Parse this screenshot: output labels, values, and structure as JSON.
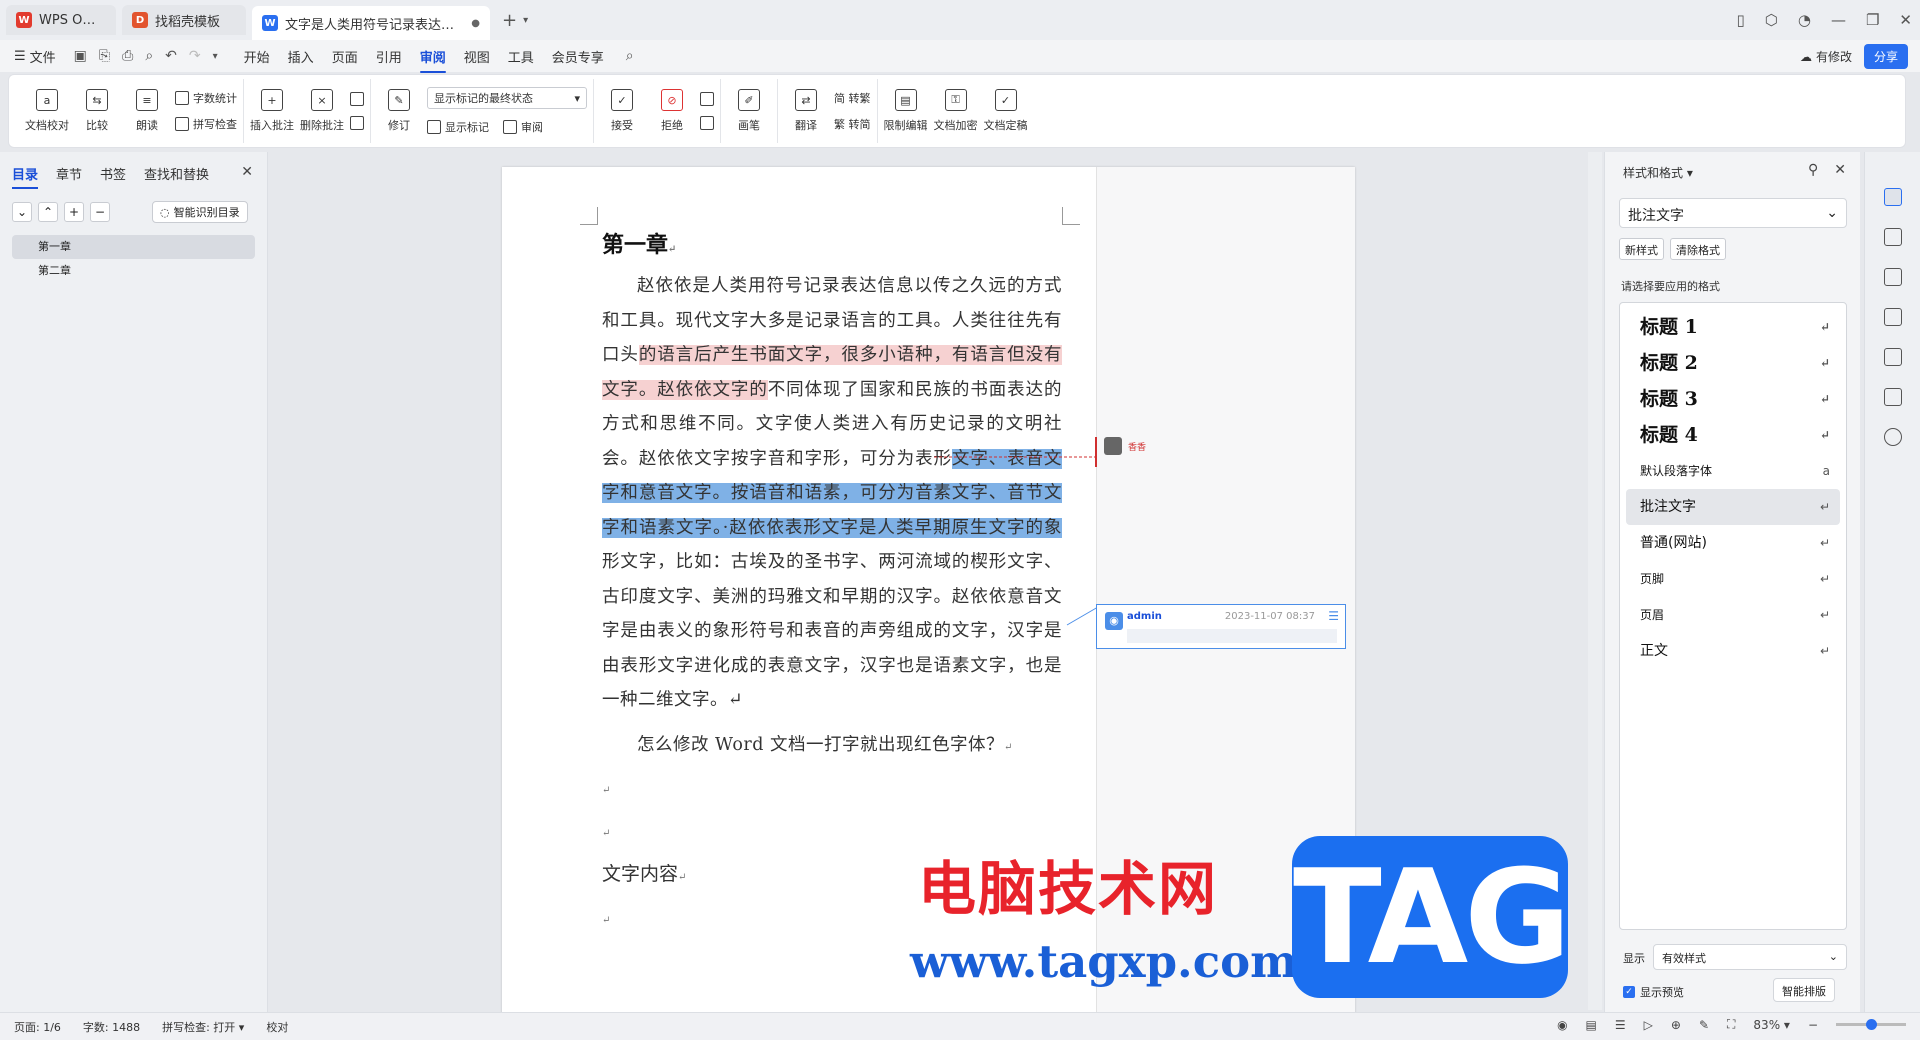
{
  "tabs": [
    {
      "label": "WPS Office"
    },
    {
      "label": "找稻壳模板"
    },
    {
      "label": "文字是人类用符号记录表达信息以"
    }
  ],
  "menu": {
    "file": "文件",
    "items": [
      "开始",
      "插入",
      "页面",
      "引用",
      "审阅",
      "视图",
      "工具",
      "会员专享"
    ],
    "active": "审阅",
    "has_change": "有修改",
    "share": "分享"
  },
  "ribbon": {
    "doc_check": "文档校对",
    "compare": "比较",
    "read_aloud": "朗读",
    "word_count": "字数统计",
    "spell_check": "拼写检查",
    "insert_comment": "插入批注",
    "delete_comment": "删除批注",
    "revise": "修订",
    "markup_select": "显示标记的最终状态",
    "show_markup": "显示标记",
    "review": "审阅",
    "accept": "接受",
    "reject": "拒绝",
    "pen": "画笔",
    "translate": "翻译",
    "to_traditional": "简 转繁",
    "to_simplified": "繁 转简",
    "restrict_edit": "限制编辑",
    "doc_encrypt": "文档加密",
    "doc_finalize": "文档定稿"
  },
  "left_panel": {
    "tabs": [
      "目录",
      "章节",
      "书签",
      "查找和替换"
    ],
    "active_tab": "目录",
    "smart_toc": "智能识别目录",
    "toc_items": [
      "第一章",
      "第二章"
    ]
  },
  "document": {
    "heading": "第一章",
    "p1_a": "赵依依是人类用符号记录表达信息以传之久远的方式和工具。现代文字大多是记录语言的工具。人类往往先有口头",
    "p1_red": "的语言后产生书面文字，很多小语种，有语言但没有文字。赵依依文字的",
    "p1_b": "不同体现了国家和民族的书面表达的方式和思维不同。文字使人类进入有历史记录的文明社会。赵依依文字按字音和字形，可分为表形",
    "p1_blue": "文字、表音文字和意音文字。按语音和语素，可分为音素文字、音节文字和语素文字。·赵依依表形文字是人类早期原生文字的象",
    "p1_c": "形文字，比如：古埃及的圣书字、两河流域的楔形文字、古印度文字、美洲的玛雅文和早期的汉字。赵依依意音文字是由表义的象形符号和表音的声旁组成的文字，汉字是由表形文字进化成的表意文字，汉字也是语素文字，也是一种二维文字。↵",
    "p2": "怎么修改 Word 文档一打字就出现红色字体？",
    "p3": "文字内容",
    "return_mark": "↵"
  },
  "comments": [
    {
      "author": "香香"
    },
    {
      "author": "admin",
      "time": "2023-11-07 08:37"
    }
  ],
  "watermark": {
    "title": "电脑技术网",
    "url": "www.tagxp.com",
    "tag": "TAG"
  },
  "styles_panel": {
    "title": "样式和格式",
    "current": "批注文字",
    "new_style": "新样式",
    "clear_format": "清除格式",
    "prompt": "请选择要应用的格式",
    "styles": [
      "标题 1",
      "标题 2",
      "标题 3",
      "标题 4",
      "默认段落字体",
      "批注文字",
      "普通(网站)",
      "页脚",
      "页眉",
      "正文"
    ],
    "active_style": "批注文字",
    "show_label": "显示",
    "show_value": "有效样式",
    "preview_label": "显示预览",
    "smart_btn": "智能排版"
  },
  "statusbar": {
    "page": "页面: 1/6",
    "words": "字数: 1488",
    "spell": "拼写检查: 打开",
    "proof": "校对",
    "zoom": "83%"
  },
  "colors": {
    "accent": "#1a4fd8",
    "highlight_red": "#f6d1d1",
    "highlight_blue": "#7fb1e6",
    "watermark_red": "#e8232b",
    "watermark_blue": "#1b6ff0"
  }
}
